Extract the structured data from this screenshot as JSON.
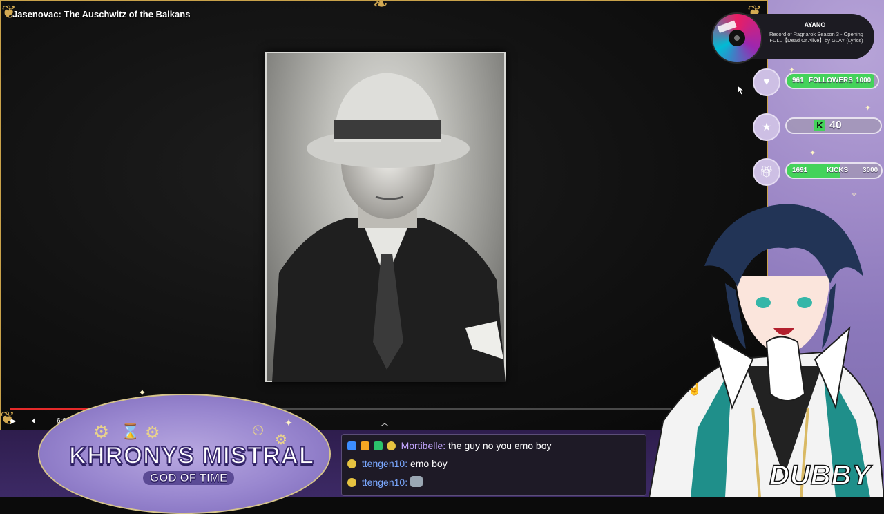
{
  "video": {
    "title": "Jasenovac: The Auschwitz of the Balkans",
    "time": "6:05 / 40:56",
    "progress": 0.1486
  },
  "music": {
    "artist": "AYANO",
    "song": "Record of Ragnarok Season 3 - Opening FULL【Dead Or Alive】by GLAY (Lyrics)"
  },
  "stats": {
    "followers": {
      "current": "961",
      "label": "FOLLOWERS",
      "goal": "1000",
      "progress": 0.961
    },
    "kick_count": {
      "value": "40"
    },
    "kicks": {
      "current": "1691",
      "label": "KICKS",
      "goal": "3000",
      "progress": 0.5637
    }
  },
  "banner": {
    "title": "KHRONYS MISTRAL",
    "subtitle": "GOD OF TIME"
  },
  "chat": [
    {
      "user": "Mortibelle",
      "message": "the guy no you emo boy"
    },
    {
      "user": "ttengen10",
      "message": "emo boy"
    },
    {
      "user": "ttengen10",
      "message": ""
    }
  ],
  "watermark": "DUBBY",
  "colors": {
    "frame_gold": "#c9a24a",
    "progress_red": "#e52a2a",
    "goal_green": "#44d35a",
    "panel_purple": "#9f8ac8"
  }
}
